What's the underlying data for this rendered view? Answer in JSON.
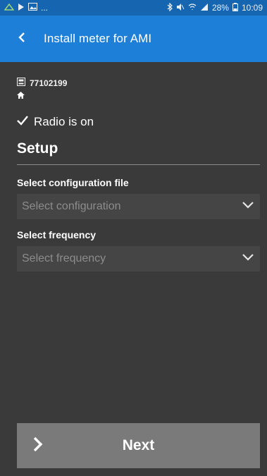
{
  "status_bar": {
    "left_overflow": "...",
    "battery": "28%",
    "time": "10:09"
  },
  "app_bar": {
    "back_icon": "chevron-left-icon",
    "title": "Install meter for AMI"
  },
  "meter": {
    "icon": "meter-icon",
    "id": "77102199",
    "home_icon": "home-icon"
  },
  "radio_status": {
    "icon": "checkmark-icon",
    "text": "Radio is on"
  },
  "setup": {
    "title": "Setup",
    "config": {
      "label": "Select configuration file",
      "placeholder": "Select configuration",
      "icon": "chevron-down-icon"
    },
    "frequency": {
      "label": "Select frequency",
      "placeholder": "Select frequency",
      "icon": "chevron-down-icon"
    }
  },
  "next_button": {
    "icon": "chevron-right-icon",
    "label": "Next"
  },
  "colors": {
    "status_bar": "#1565b0",
    "app_bar": "#1e7fd9",
    "background": "#3a3a3a",
    "select_bg": "#454545",
    "button_bg": "#7a7a7a"
  }
}
